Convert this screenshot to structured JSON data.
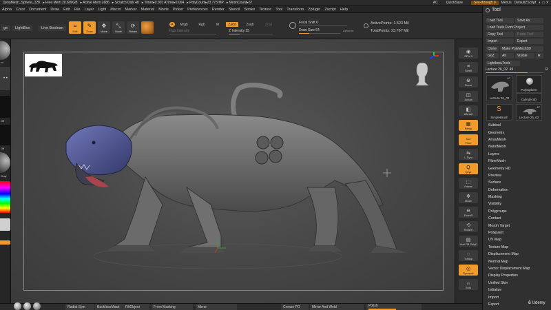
{
  "topbar": {
    "title": "DynaMesh_Sphere_128",
    "free_mem": "▸ Free Mem 20.609GB",
    "active_mem": "▸ Active Mem 2686",
    "scratch_disk": "▸ Scratch Disk 48",
    "timer": "▸ Timer▸0.001 ATime▸0.004",
    "poly_count": "▸ PolyCount▸23.773 MP",
    "mesh_count": "▸ MeshCount▸67",
    "ac": "AC",
    "quicksave": "QuickSave",
    "see_through": "See-through 0",
    "menus": "Menus",
    "default_zscript": "DefaultZScript"
  },
  "menus": [
    "Alpha",
    "Color",
    "Document",
    "Draw",
    "Edit",
    "File",
    "Layer",
    "Light",
    "Macro",
    "Marker",
    "Material",
    "Movie",
    "Picker",
    "Preferences",
    "Render",
    "Stencil",
    "Stroke",
    "Texture",
    "Tool",
    "Transform",
    "Zplugin",
    "Zscript",
    "Help"
  ],
  "toolstrip": {
    "left_partial": "ge",
    "lightbox": "LightBox",
    "live_boolean": "Live Boolean",
    "buttons": [
      {
        "label": "Edit",
        "active": true
      },
      {
        "label": "Draw",
        "active": true
      },
      {
        "label": "Move",
        "active": false
      },
      {
        "label": "Scale",
        "active": false
      },
      {
        "label": "Rotate",
        "active": false
      }
    ],
    "a_label": "A",
    "mrgb": "Mrgb",
    "rgb": "Rgb",
    "m": "M",
    "zadd": "Zadd",
    "zsub": "Zsub",
    "zcut": "Zcut",
    "rgb_intensity": "Rgb Intensity",
    "z_intensity": "Z Intensity 25",
    "z_intensity_value": 25,
    "focal_shift": "Focal Shift 0",
    "draw_size": "Draw Size 64",
    "draw_size_value": 64,
    "dynamic": "Dynamic",
    "active_points": "ActivePoints: 1.523 Mil",
    "total_points": "TotalPoints: 23.767 Mil"
  },
  "leftshelf": {
    "labels": [
      "rd",
      "Off",
      "Off",
      "Gray"
    ]
  },
  "rightshelf": {
    "buttons": [
      "SPix 3",
      "Scroll",
      "Zoom",
      "Actual",
      "AAHalf",
      "Persp",
      "Floor",
      "L.Sym",
      "Qxyz",
      "Frame",
      "Move",
      "ZoomD",
      "RotaTe",
      "Line Fill PolyF",
      "Transp",
      "Dynamic",
      "Solo"
    ],
    "active": [
      "Persp",
      "Floor",
      "Qxyz",
      "Dynamic"
    ]
  },
  "palette": {
    "title": "Tool",
    "load_tool": "Load Tool",
    "save_as": "Save As",
    "load_tools_from_project": "Load Tools From Project",
    "copy_tool": "Copy Tool",
    "paste_tool": "Paste Tool",
    "import": "Import",
    "export": "Export",
    "clone": "Clone",
    "make_polymesh3d": "Make PolyMesh3D",
    "goz": "GoZ",
    "all": "All",
    "visible": "Visible",
    "r": "R",
    "lightbox_tools": "Lightbox▸Tools",
    "lecture_slider": "Lecture 26_02. 49",
    "lecture_value": 49,
    "thumbs": [
      {
        "label": "Lecture 26_02",
        "badge": "67"
      },
      {
        "label": "PolySphere",
        "badge": ""
      },
      {
        "label": "Cylinder3D",
        "badge": ""
      },
      {
        "label": "SimpleBrush",
        "badge": ""
      },
      {
        "label": "Lecture 26_02",
        "badge": "67"
      }
    ],
    "subpalettes": [
      "Subtool",
      "Geometry",
      "ArrayMesh",
      "NanoMesh",
      "Layers",
      "FiberMesh",
      "Geometry HD",
      "Preview",
      "Surface",
      "Deformation",
      "Masking",
      "Visibility",
      "Polygroups",
      "Contact",
      "Morph Target",
      "Polypaint",
      "UV Map",
      "Texture Map",
      "Displacement Map",
      "Normal Map",
      "Vector Displacement Map",
      "Display Properties",
      "Unified Skin",
      "Initialize",
      "Import",
      "Export"
    ]
  },
  "bottombar": {
    "radial_sym": "Radial Sym",
    "backface_mask": "BackfaceMask",
    "fill_object": "FillObject",
    "from_masking": "From Masking",
    "mirror": "Mirror",
    "create_pg": "Crease PG",
    "mirror_and_weld": "Mirror And Weld",
    "polish": "Polish",
    "udemy": "Udemy"
  }
}
